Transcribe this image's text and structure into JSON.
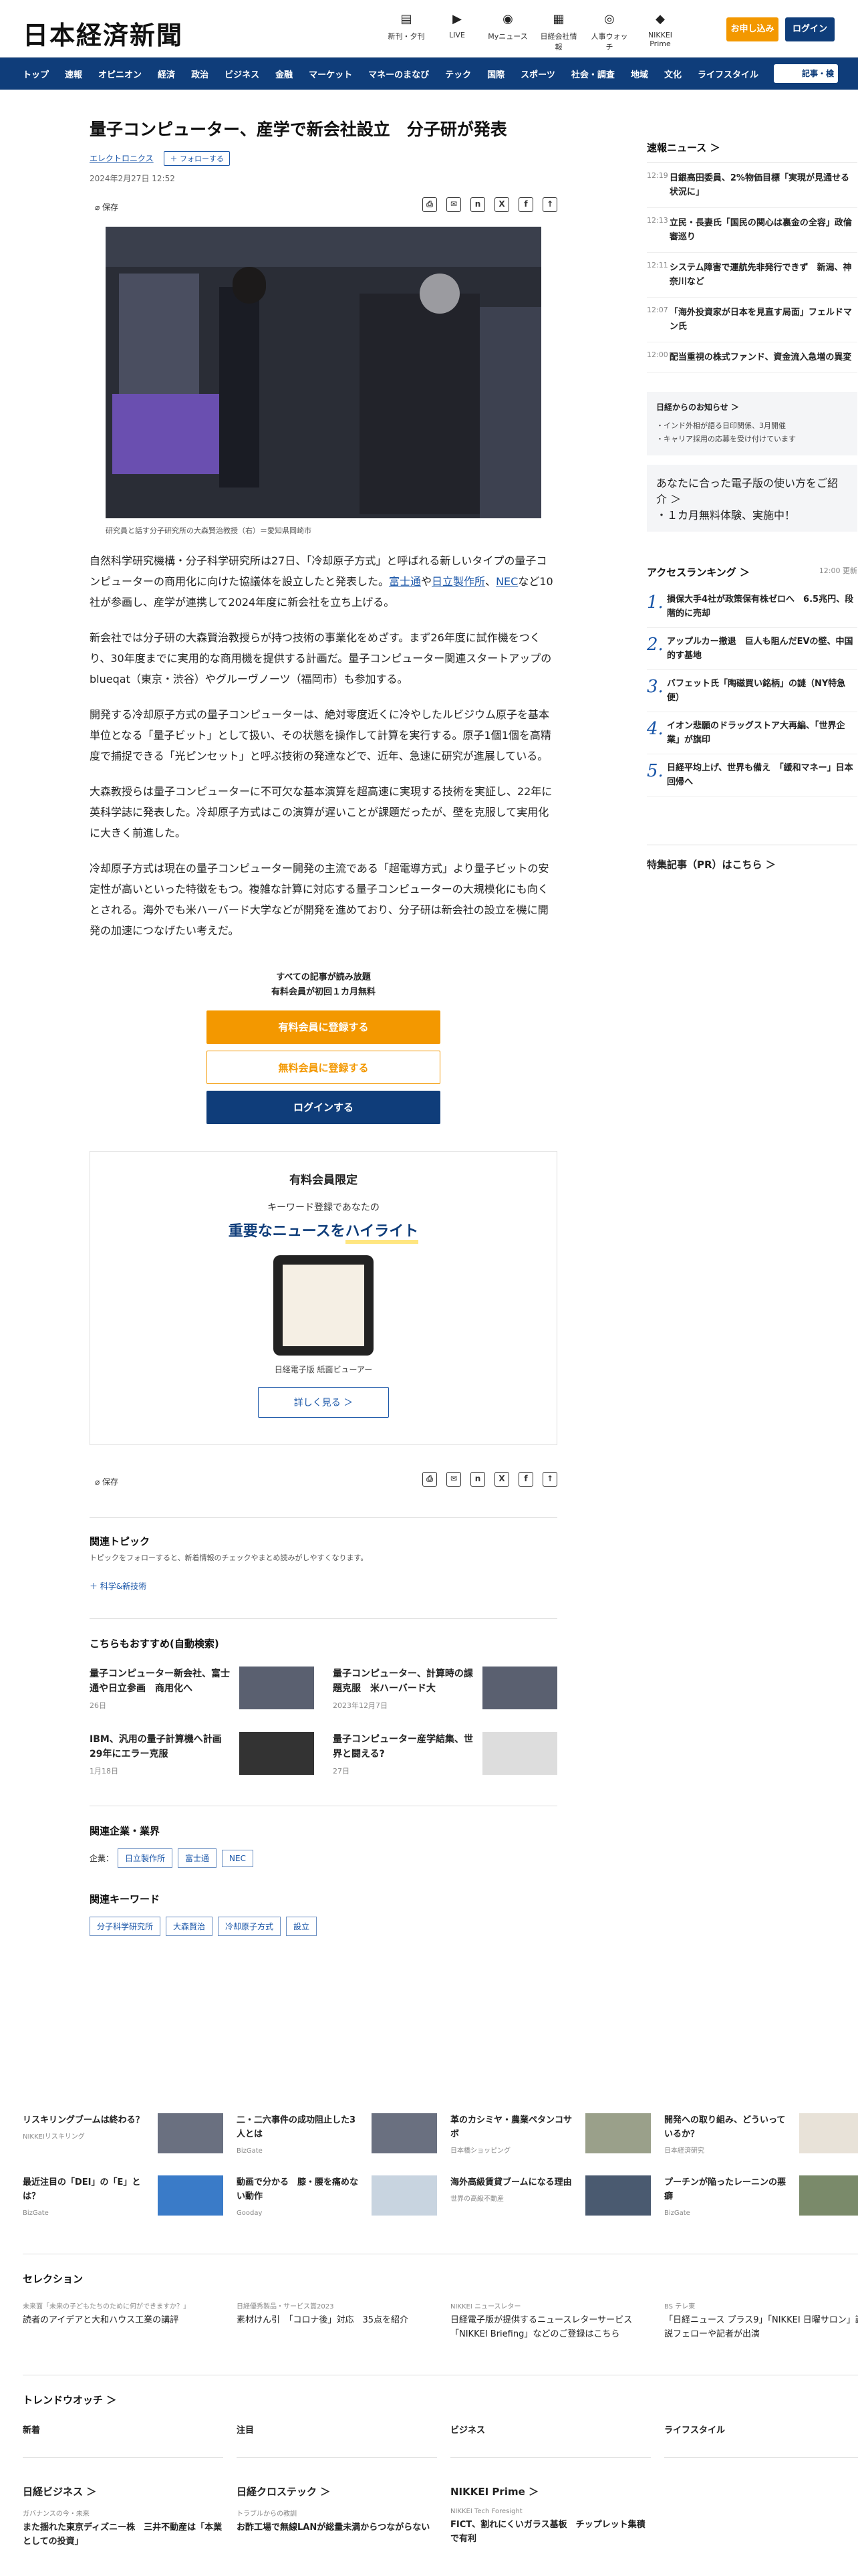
{
  "header": {
    "logo": "日本経済新聞",
    "icons": [
      {
        "label": "新刊・夕刊",
        "icon": "newspaper-icon"
      },
      {
        "label": "LIVE",
        "icon": "video-icon"
      },
      {
        "label": "Myニュース",
        "icon": "user-icon"
      },
      {
        "label": "日経会社情報",
        "icon": "building-icon"
      },
      {
        "label": "人事ウォッチ",
        "icon": "person-watch-icon"
      },
      {
        "label": "NIKKEI Prime",
        "icon": "prime-icon"
      }
    ],
    "subscribe": "お申し込み",
    "login": "ログイン"
  },
  "nav": {
    "items": [
      "トップ",
      "速報",
      "オピニオン",
      "経済",
      "政治",
      "ビジネス",
      "金融",
      "マーケット",
      "マネーのまなび",
      "テック",
      "国際",
      "スポーツ",
      "社会・調査",
      "地域",
      "文化",
      "ライフスタイル"
    ],
    "search_placeholder": "記事・検"
  },
  "article": {
    "title": "量子コンピューター、産学で新会社設立　分子研が発表",
    "topic_tag": "エレクトロニクス",
    "follow_label": "フォローする",
    "date": "2024年2月27日 12:52",
    "save_label": "保存",
    "caption": "研究員と話す分子研究所の大森賢治教授（右）＝愛知県岡崎市",
    "p1_a": "自然科学研究機構・分子科学研究所は27日、「冷却原子方式」と呼ばれる新しいタイプの量子コンピューターの商用化に向けた協議体を設立したと発表した。",
    "p1_link1": "富士通",
    "p1_b": "や",
    "p1_link2": "日立製作所",
    "p1_c": "、",
    "p1_link3": "NEC",
    "p1_d": "など10社が参画し、産学が連携して2024年度に新会社を立ち上げる。",
    "p2": "新会社では分子研の大森賢治教授らが持つ技術の事業化をめざす。まず26年度に試作機をつくり、30年度までに実用的な商用機を提供する計画だ。量子コンピューター関連スタートアップのblueqat（東京・渋谷）やグルーヴノーツ（福岡市）も参加する。",
    "p3": "開発する冷却原子方式の量子コンピューターは、絶対零度近くに冷やしたルビジウム原子を基本単位となる「量子ビット」として扱い、その状態を操作して計算を実行する。原子1個1個を高精度で捕捉できる「光ピンセット」と呼ぶ技術の発達などで、近年、急速に研究が進展している。",
    "p4": "大森教授らは量子コンピューターに不可欠な基本演算を超高速に実現する技術を実証し、22年に英科学誌に発表した。冷却原子方式はこの演算が遅いことが課題だったが、壁を克服して実用化に大きく前進した。",
    "p5": "冷却原子方式は現在の量子コンピューター開発の主流である「超電導方式」より量子ビットの安定性が高いといった特徴をもつ。複雑な計算に対応する量子コンピューターの大規模化にも向くとされる。海外でも米ハーバード大学などが開発を進めており、分子研は新会社の設立を機に開発の加速につなげたい考えだ。"
  },
  "paywall": {
    "line1": "すべての記事が読み放題",
    "line2": "有料会員が初回１カ月無料",
    "btn_paid": "有料会員に登録する",
    "btn_free": "無料会員に登録する",
    "btn_login": "ログインする"
  },
  "promo": {
    "title": "有料会員限定",
    "sub": "キーワード登録であなたの",
    "headline_a": "重要なニュースを",
    "headline_b": "ハイライト",
    "device_label": "日経電子版 紙面ビューアー",
    "more": "詳しく見る ＞"
  },
  "related_topic": {
    "title": "関連トピック",
    "sub": "トピックをフォローすると、新着情報のチェックやまとめ読みがしやすくなります。",
    "tag": "＋ 科学&新技術"
  },
  "recommend": {
    "title": "こちらもおすすめ(自動検索)",
    "items": [
      {
        "title": "量子コンピューター新会社、富士通や日立参画　商用化へ",
        "date": "26日"
      },
      {
        "title": "量子コンピューター、計算時の課題克服　米ハーバード大",
        "date": "2023年12月7日"
      },
      {
        "title": "IBM、汎用の量子計算機へ計画　29年にエラー克服",
        "date": "1月18日"
      },
      {
        "title": "量子コンピューター産学結集、世界と闘える?",
        "date": "27日"
      }
    ]
  },
  "companies": {
    "title": "関連企業・業界",
    "label": "企業：",
    "items": [
      "日立製作所",
      "富士通",
      "NEC"
    ]
  },
  "keywords": {
    "title": "関連キーワード",
    "items": [
      "分子科学研究所",
      "大森賢治",
      "冷却原子方式",
      "設立"
    ]
  },
  "sidebar": {
    "breaking_title": "速報ニュース ＞",
    "breaking": [
      {
        "time": "12:19",
        "title": "日銀高田委員、2%物価目標「実現が見通せる状況に」"
      },
      {
        "time": "12:13",
        "title": "立民・長妻氏「国民の関心は裏金の全容」政倫審巡り"
      },
      {
        "time": "12:11",
        "title": "システム障害で運航先非発行できず　新潟、神奈川など"
      },
      {
        "time": "12:07",
        "title": "「海外投資家が日本を見直す局面」フェルドマン氏"
      },
      {
        "time": "12:00",
        "title": "配当重視の株式ファンド、資金流入急増の異変"
      }
    ],
    "notice_title": "日経からのお知らせ ＞",
    "notice_items": [
      "・インド外相が語る日印関係、3月開催",
      "・キャリア採用の応募を受け付けています"
    ],
    "notice2_title": "あなたに合った電子版の使い方をご紹介 ＞",
    "notice2_item": "・１カ月無料体験、実施中！",
    "ranking_title": "アクセスランキング ＞",
    "ranking_time": "12:00 更新",
    "ranking": [
      {
        "n": "1.",
        "title": "損保大手4社が政策保有株ゼロへ　6.5兆円、段階的に売却"
      },
      {
        "n": "2.",
        "title": "アップルカー撤退　巨人も阻んだEVの壁、中国的す基地"
      },
      {
        "n": "3.",
        "title": "バフェット氏「陶磁買い銘柄」の謎（NY特急便）"
      },
      {
        "n": "4.",
        "title": "イオン悲願のドラッグストア大再編、「世界企業」が旗印"
      },
      {
        "n": "5.",
        "title": "日経平均上げ、世界も備え　「緩和マネー」日本回帰へ"
      }
    ],
    "pr_title": "特集記事（PR）はこちら ＞"
  },
  "bottom_ads": [
    {
      "title": "リスキリングブームは終わる？",
      "source": "NIKKEIリスキリング"
    },
    {
      "title": "二・二六事件の成功阻止した3人とは",
      "source": "BizGate"
    },
    {
      "title": "革のカシミヤ・農業ペタンコサボ",
      "source": "日本橋ショッピング"
    },
    {
      "title": "開発への取り組み、どういっているか？",
      "source": "日本経済研究"
    },
    {
      "title": "最近注目の「DEI」の「E」とは？",
      "source": "BizGate"
    },
    {
      "title": "動画で分かる　膝・腰を痛めない動作",
      "source": "Gooday"
    },
    {
      "title": "海外高級賃貸ブームになる理由",
      "source": "世界の高級不動産"
    },
    {
      "title": "プーチンが陥ったレーニンの悪癖",
      "source": "BizGate"
    }
  ],
  "selection": {
    "title": "セレクション",
    "items": [
      {
        "src": "未来面「未来の子どもたちのために何ができますか？」",
        "title": "読者のアイデアと大和ハウス工業の講評"
      },
      {
        "src": "日経優秀製品・サービス賞2023",
        "title": "素材けん引　「コロナ後」対応　35点を紹介"
      },
      {
        "src": "NIKKEI ニュースレター",
        "title": "日経電子版が提供するニュースレターサービス「NIKKEI Briefing」などのご登録はこちら"
      },
      {
        "src": "BS テレ東",
        "title": "「日経ニュース プラス9」「NIKKEI 日曜サロン」論説フェローや記者が出演"
      }
    ]
  },
  "trend": {
    "title": "トレンドウオッチ ＞",
    "cols": [
      "新着",
      "注目",
      "ビジネス",
      "ライフスタイル"
    ]
  },
  "brands": [
    {
      "name": "日経ビジネス ＞",
      "sub": "ガバナンスの今・未来",
      "title": "また揺れた東京ディズニー株　三井不動産は「本業としての投資」"
    },
    {
      "name": "日経クロステック ＞",
      "sub": "トラブルからの教訓",
      "title": "お酢工場で無線LANが総量未満からつながらない"
    },
    {
      "name": "NIKKEI Prime ＞",
      "sub": "NIKKEI Tech Foresight",
      "title": "FICT、割れにくいガラス基板　チップレット集積で有利"
    }
  ]
}
